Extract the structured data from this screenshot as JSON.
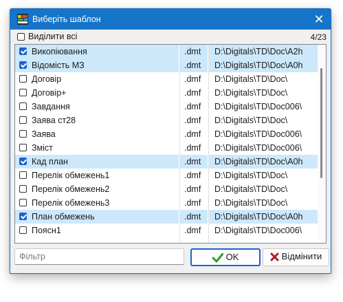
{
  "window": {
    "title": "Виберіть шаблон",
    "close_glyph": "✕"
  },
  "header": {
    "select_all_label": "Виділити всі",
    "counter": "4/23"
  },
  "rows": [
    {
      "name": "Викопіювання",
      "ext": ".dmt",
      "path": "D:\\Digitals\\TD\\Doc\\A2h",
      "checked": true
    },
    {
      "name": "Відомість МЗ",
      "ext": ".dmt",
      "path": "D:\\Digitals\\TD\\Doc\\A0h",
      "checked": true
    },
    {
      "name": "Договір",
      "ext": ".dmf",
      "path": "D:\\Digitals\\TD\\Doc\\",
      "checked": false
    },
    {
      "name": "Договір+",
      "ext": ".dmf",
      "path": "D:\\Digitals\\TD\\Doc\\",
      "checked": false
    },
    {
      "name": "Завдання",
      "ext": ".dmf",
      "path": "D:\\Digitals\\TD\\Doc006\\",
      "checked": false
    },
    {
      "name": "Заява ст28",
      "ext": ".dmf",
      "path": "D:\\Digitals\\TD\\Doc\\",
      "checked": false
    },
    {
      "name": "Заява",
      "ext": ".dmf",
      "path": "D:\\Digitals\\TD\\Doc006\\",
      "checked": false
    },
    {
      "name": "Зміст",
      "ext": ".dmf",
      "path": "D:\\Digitals\\TD\\Doc006\\",
      "checked": false
    },
    {
      "name": "Кад план",
      "ext": ".dmt",
      "path": "D:\\Digitals\\TD\\Doc\\A0h",
      "checked": true
    },
    {
      "name": "Перелік обмежень1",
      "ext": ".dmf",
      "path": "D:\\Digitals\\TD\\Doc\\",
      "checked": false
    },
    {
      "name": "Перелік обмежень2",
      "ext": ".dmf",
      "path": "D:\\Digitals\\TD\\Doc\\",
      "checked": false
    },
    {
      "name": "Перелік обмежень3",
      "ext": ".dmf",
      "path": "D:\\Digitals\\TD\\Doc\\",
      "checked": false
    },
    {
      "name": "План обмежень",
      "ext": ".dmt",
      "path": "D:\\Digitals\\TD\\Doc\\A0h",
      "checked": true
    },
    {
      "name": "Поясн1",
      "ext": ".dmf",
      "path": "D:\\Digitals\\TD\\Doc006\\",
      "checked": false
    }
  ],
  "footer": {
    "filter_placeholder": "Фільтр",
    "ok_label": "OK",
    "cancel_label": "Відмінити"
  },
  "colors": {
    "title_bar": "#1674c9",
    "selected_row": "#cde8fb",
    "checkbox_checked": "#1b64c8",
    "ok_icon": "#2a9d2a",
    "cancel_icon": "#b01c1c"
  }
}
